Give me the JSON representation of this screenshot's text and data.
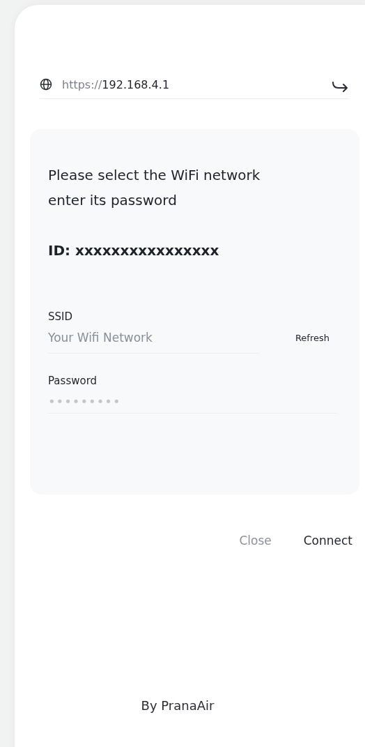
{
  "url": {
    "scheme": "https://",
    "host": "192.168.4.1"
  },
  "form": {
    "title": "Please select the WiFi network enter its password",
    "device_id": "ID: xxxxxxxxxxxxxxxx",
    "ssid": {
      "label": "SSID",
      "placeholder": "Your Wifi Network",
      "refresh": "Refresh"
    },
    "password": {
      "label": "Password",
      "value": "•••••••••"
    }
  },
  "buttons": [
    {
      "label": "Close",
      "kind": "secondary"
    },
    {
      "label": "Connect",
      "kind": "primary"
    }
  ],
  "footer": "By PranaAir"
}
